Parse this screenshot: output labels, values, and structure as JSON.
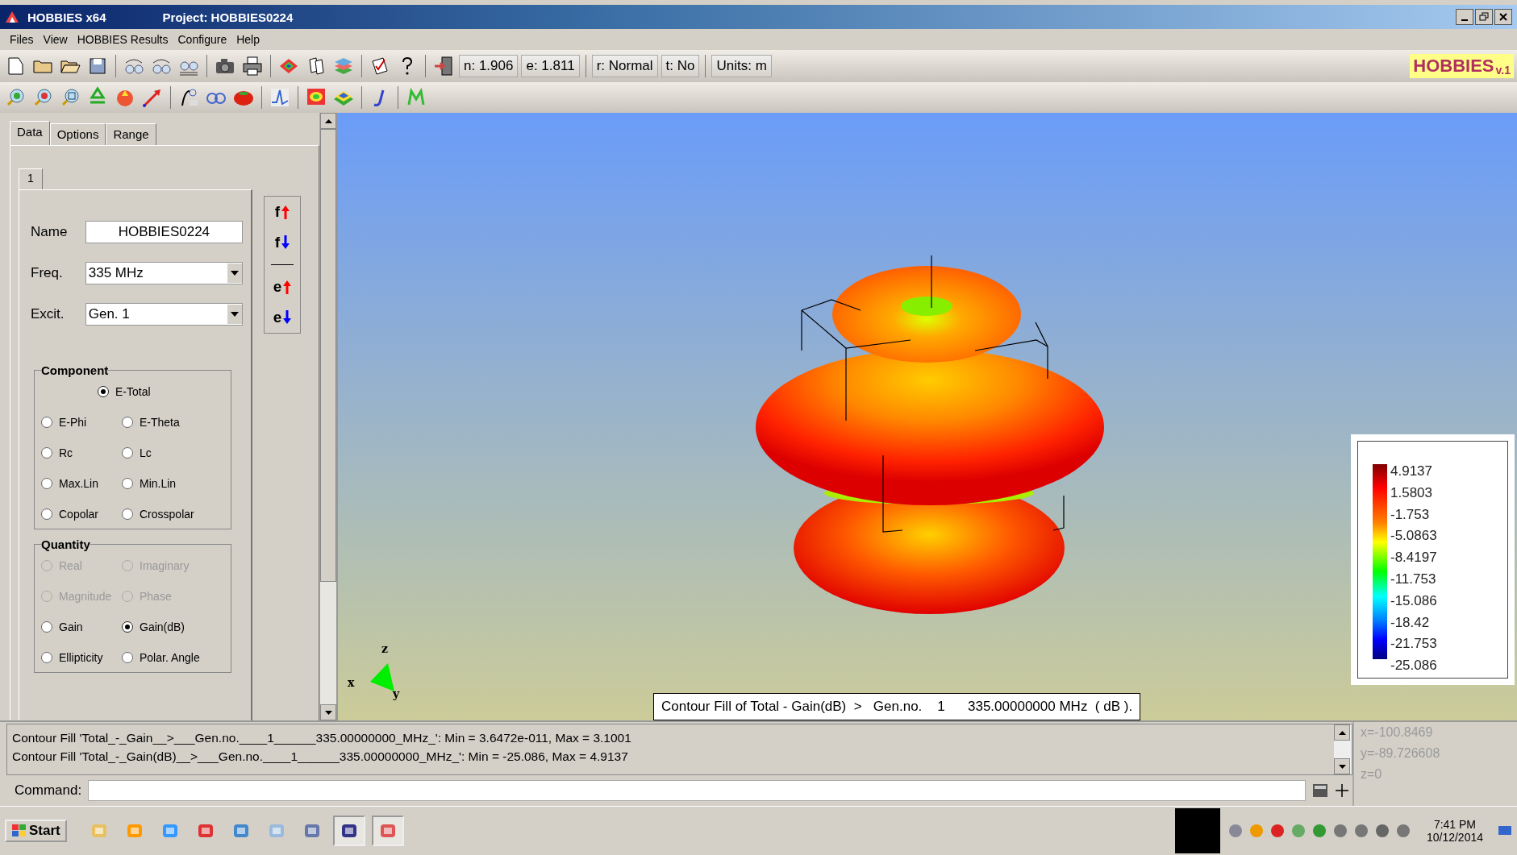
{
  "window": {
    "title": "HOBBIES x64",
    "project": "Project: HOBBIES0224"
  },
  "menu": [
    "Files",
    "View",
    "HOBBIES Results",
    "Configure",
    "Help"
  ],
  "toolbar": {
    "readouts": [
      "n: 1.906",
      "e: 1.811",
      "r: Normal",
      "t: No",
      "Units: m"
    ],
    "logo": "HOBBIES",
    "logo_version": "v.1"
  },
  "panel": {
    "tabs": [
      {
        "label": "Data",
        "selected": true
      },
      {
        "label": "Options",
        "selected": false
      },
      {
        "label": "Range",
        "selected": false
      }
    ],
    "subtabs": [
      {
        "label": "1",
        "selected": true
      }
    ],
    "fields": [
      {
        "kind": "text",
        "label": "Name",
        "value": "HOBBIES0224"
      },
      {
        "kind": "dropdown",
        "label": "Freq.",
        "value": "335 MHz"
      },
      {
        "kind": "dropdown",
        "label": "Excit.",
        "value": "Gen. 1"
      }
    ],
    "side_buttons": [
      {
        "kind": "up",
        "letter": "f",
        "color": "#ff0000"
      },
      {
        "kind": "down",
        "letter": "f",
        "color": "#0000ff"
      },
      {
        "kind": "up",
        "letter": "e",
        "color": "#ff0000"
      },
      {
        "kind": "down",
        "letter": "e",
        "color": "#0000ff"
      }
    ],
    "component": {
      "title": "Component",
      "options": [
        {
          "label": "E-Total",
          "selected": true
        },
        {
          "label": "E-Phi",
          "selected": false
        },
        {
          "label": "E-Theta",
          "selected": false
        },
        {
          "label": "Rc",
          "selected": false
        },
        {
          "label": "Lc",
          "selected": false
        },
        {
          "label": "Max.Lin",
          "selected": false
        },
        {
          "label": "Min.Lin",
          "selected": false
        },
        {
          "label": "Copolar",
          "selected": false
        },
        {
          "label": "Crosspolar",
          "selected": false
        }
      ]
    },
    "quantity": {
      "title": "Quantity",
      "options": [
        {
          "label": "Real",
          "selected": false,
          "disabled": true
        },
        {
          "label": "Imaginary",
          "selected": false,
          "disabled": true
        },
        {
          "label": "Magnitude",
          "selected": false,
          "disabled": true
        },
        {
          "label": "Phase",
          "selected": false,
          "disabled": true
        },
        {
          "label": "Gain",
          "selected": false,
          "disabled": false
        },
        {
          "label": "Gain(dB)",
          "selected": true,
          "disabled": false
        },
        {
          "label": "Ellipticity",
          "selected": false,
          "disabled": false
        },
        {
          "label": "Polar. Angle",
          "selected": false,
          "disabled": false
        }
      ]
    }
  },
  "view": {
    "axes": {
      "x": "x",
      "y": "y",
      "z": "z"
    },
    "caption": "Contour Fill of Total - Gain(dB)  >   Gen.no.    1      335.00000000 MHz  ( dB ).",
    "legend": [
      "4.9137",
      "1.5803",
      "-1.753",
      "-5.0863",
      "-8.4197",
      "-11.753",
      "-15.086",
      "-18.42",
      "-21.753",
      "-25.086"
    ]
  },
  "log": [
    "Contour Fill 'Total_-_Gain__>___Gen.no.____1______335.00000000_MHz_': Min = 3.6472e-011, Max = 3.1001",
    "Contour Fill 'Total_-_Gain(dB)__>___Gen.no.____1______335.00000000_MHz_': Min = -25.086, Max = 4.9137"
  ],
  "coords": [
    "x=-100.8469",
    "y=-89.726608",
    "z=0"
  ],
  "command": {
    "label": "Command:"
  },
  "taskbar": {
    "start": "Start",
    "time": "7:41 PM",
    "date": "10/12/2014"
  }
}
